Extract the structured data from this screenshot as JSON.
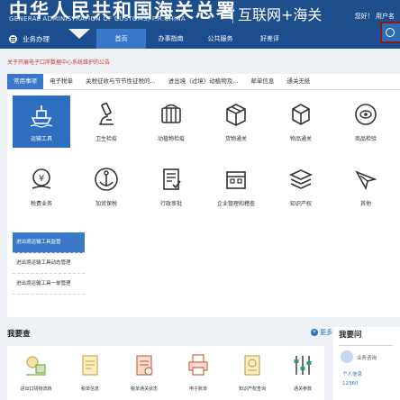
{
  "header": {
    "title_cn": "中华人民共和国海关总署",
    "title_en": "GENERAL ADMINISTRATION OF CUSTOMS, P.R.CHINA",
    "portal": "互联网+海关",
    "user": "您好！ 用户名"
  },
  "nav": {
    "left_label": "业务办理",
    "tabs": [
      {
        "label": "首页"
      },
      {
        "label": "办事指南"
      },
      {
        "label": "公共服务"
      },
      {
        "label": "好差评"
      }
    ]
  },
  "notice": "关于开展电子口岸数据中心系统维护的公告",
  "panel": {
    "tabs": [
      {
        "label": "常用事项"
      },
      {
        "label": "电子税单"
      },
      {
        "label": "关税征收与节节性征税的..."
      },
      {
        "label": "进出境（过境）动植物及..."
      },
      {
        "label": "邮单信息"
      },
      {
        "label": "通关无纸"
      }
    ],
    "tiles": [
      {
        "label": "运输工具",
        "icon": "ship-icon"
      },
      {
        "label": "卫生检疫",
        "icon": "microscope-icon"
      },
      {
        "label": "动植物检疫",
        "icon": "quarantine-icon"
      },
      {
        "label": "货物通关",
        "icon": "box-icon"
      },
      {
        "label": "物品通关",
        "icon": "cube-icon"
      },
      {
        "label": "商品检验",
        "icon": "inspection-icon"
      },
      {
        "label": "税费业务",
        "icon": "tax-icon"
      },
      {
        "label": "加贸保税",
        "icon": "anchor-icon"
      },
      {
        "label": "行政审批",
        "icon": "document-icon"
      },
      {
        "label": "企业管理和稽查",
        "icon": "enterprise-icon"
      },
      {
        "label": "知识产权",
        "icon": "layers-icon"
      },
      {
        "label": "其他",
        "icon": "plane-icon"
      }
    ],
    "sublist": [
      {
        "label": "进出境运输工具监管"
      },
      {
        "label": "进出境运输工具动态管理"
      },
      {
        "label": "进出境运输工具一单管理"
      }
    ]
  },
  "query": {
    "title": "我要查",
    "more": "更多",
    "items": [
      {
        "label": "进出口货物流转",
        "icon": "goods-flow-icon"
      },
      {
        "label": "税单信息",
        "icon": "tax-receipt-icon"
      },
      {
        "label": "税单通关状态",
        "icon": "tax-status-icon"
      },
      {
        "label": "电子账单",
        "icon": "printer-icon"
      },
      {
        "label": "知识产权查询",
        "icon": "ip-query-icon"
      },
      {
        "label": "通关参数",
        "icon": "sliders-icon"
      }
    ]
  },
  "ask": {
    "title": "我要问",
    "consult": "业务咨询",
    "personal": "个人信息",
    "hotline": "12360"
  }
}
